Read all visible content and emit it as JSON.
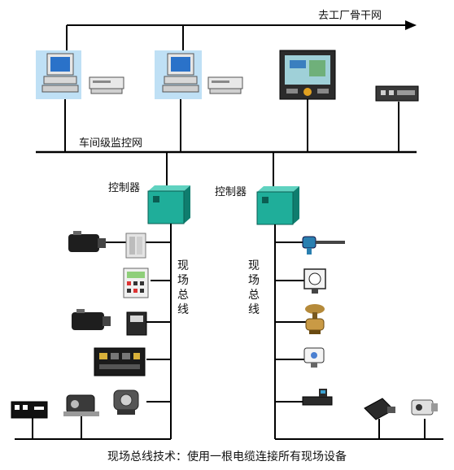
{
  "backbone_label": "去工厂骨干网",
  "workshop_network_label": "车间级监控网",
  "controllers": [
    {
      "label": "控制器"
    },
    {
      "label": "控制器"
    }
  ],
  "fieldbus_labels": [
    {
      "text": "现场总线"
    },
    {
      "text": "现场总线"
    }
  ],
  "caption": "现场总线技术：使用一根电缆连接所有现场设备",
  "colors": {
    "line": "#000000",
    "screen_blue": "#2a72c9",
    "controller_green": "#1fae9a",
    "controller_dark": "#0f7d6e",
    "monitor_bg": "#bfe0f5"
  },
  "icons": [
    "workstation-computer-icon",
    "printer-icon",
    "operator-panel-icon",
    "network-switch-icon",
    "controller-cabinet-icon",
    "motor-icon",
    "terminal-unit-icon",
    "io-module-icon",
    "plc-rack-icon",
    "valve-actuator-icon",
    "temperature-probe-icon",
    "pressure-gauge-icon",
    "control-valve-icon",
    "transmitter-icon",
    "flow-meter-icon",
    "camera-sensor-icon"
  ]
}
